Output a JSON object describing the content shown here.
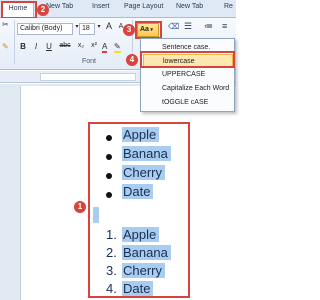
{
  "ribbon_tabs": {
    "home": "Home",
    "new_tab_1": "New Tab",
    "insert": "Insert",
    "page_layout": "Page Layout",
    "new_tab_2": "New Tab",
    "re": "Re"
  },
  "font": {
    "name": "Calibri (Body)",
    "size": "18",
    "group_label": "Font",
    "bold": "B",
    "italic": "I",
    "underline": "U",
    "strikethrough": "abc",
    "subscript": "x₂",
    "superscript": "x²",
    "grow": "A",
    "shrink": "A",
    "change_case": "Aa"
  },
  "change_case_menu": {
    "items": [
      "Sentence case.",
      "lowercase",
      "UPPERCASE",
      "Capitalize Each Word",
      "tOGGLE cASE"
    ],
    "highlighted": "lowercase"
  },
  "document": {
    "bullet_list": [
      "Apple",
      "Banana",
      "Cherry",
      "Date"
    ],
    "numbered_list": [
      {
        "num": "1.",
        "text": "Apple"
      },
      {
        "num": "2.",
        "text": "Banana"
      },
      {
        "num": "3.",
        "text": "Cherry"
      },
      {
        "num": "4.",
        "text": "Date"
      }
    ]
  },
  "step_badges": [
    "1",
    "2",
    "3",
    "4"
  ],
  "colors": {
    "annotation_red": "#d9433d",
    "selection_blue": "#a9cdf1",
    "menu_highlight": "#fde7b0"
  }
}
